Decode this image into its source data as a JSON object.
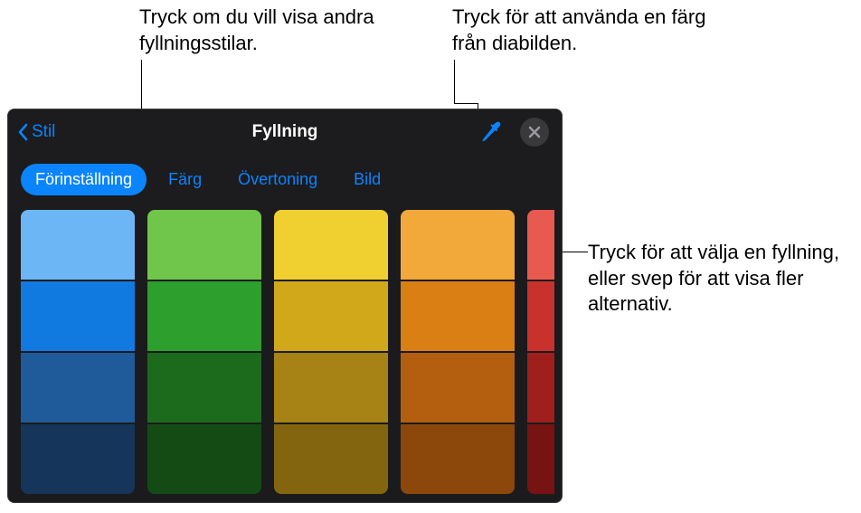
{
  "callouts": {
    "top_left": "Tryck om du vill visa andra fyllningsstilar.",
    "top_right": "Tryck för att använda en färg från diabilden.",
    "right": "Tryck för att välja en fyllning, eller svep för att visa fler alternativ."
  },
  "panel": {
    "back_label": "Stil",
    "title": "Fyllning",
    "tabs": {
      "preset": "Förinställning",
      "color": "Färg",
      "gradient": "Övertoning",
      "image": "Bild"
    }
  },
  "icons": {
    "back": "chevron-left",
    "eyedropper": "eyedropper",
    "close": "xmark"
  },
  "swatches": {
    "columns": [
      [
        "#6db6f5",
        "#107ae0",
        "#1f5b9b",
        "#16355a"
      ],
      [
        "#6fc64b",
        "#2c9f2c",
        "#1c6b1d",
        "#144b15"
      ],
      [
        "#f0d030",
        "#d1a81a",
        "#a68314",
        "#82650e"
      ],
      [
        "#f3a83a",
        "#d97f14",
        "#b35f0f",
        "#8c470a"
      ],
      [
        "#e85a4f",
        "#c9312c",
        "#9e1f1c",
        "#771312"
      ]
    ]
  }
}
